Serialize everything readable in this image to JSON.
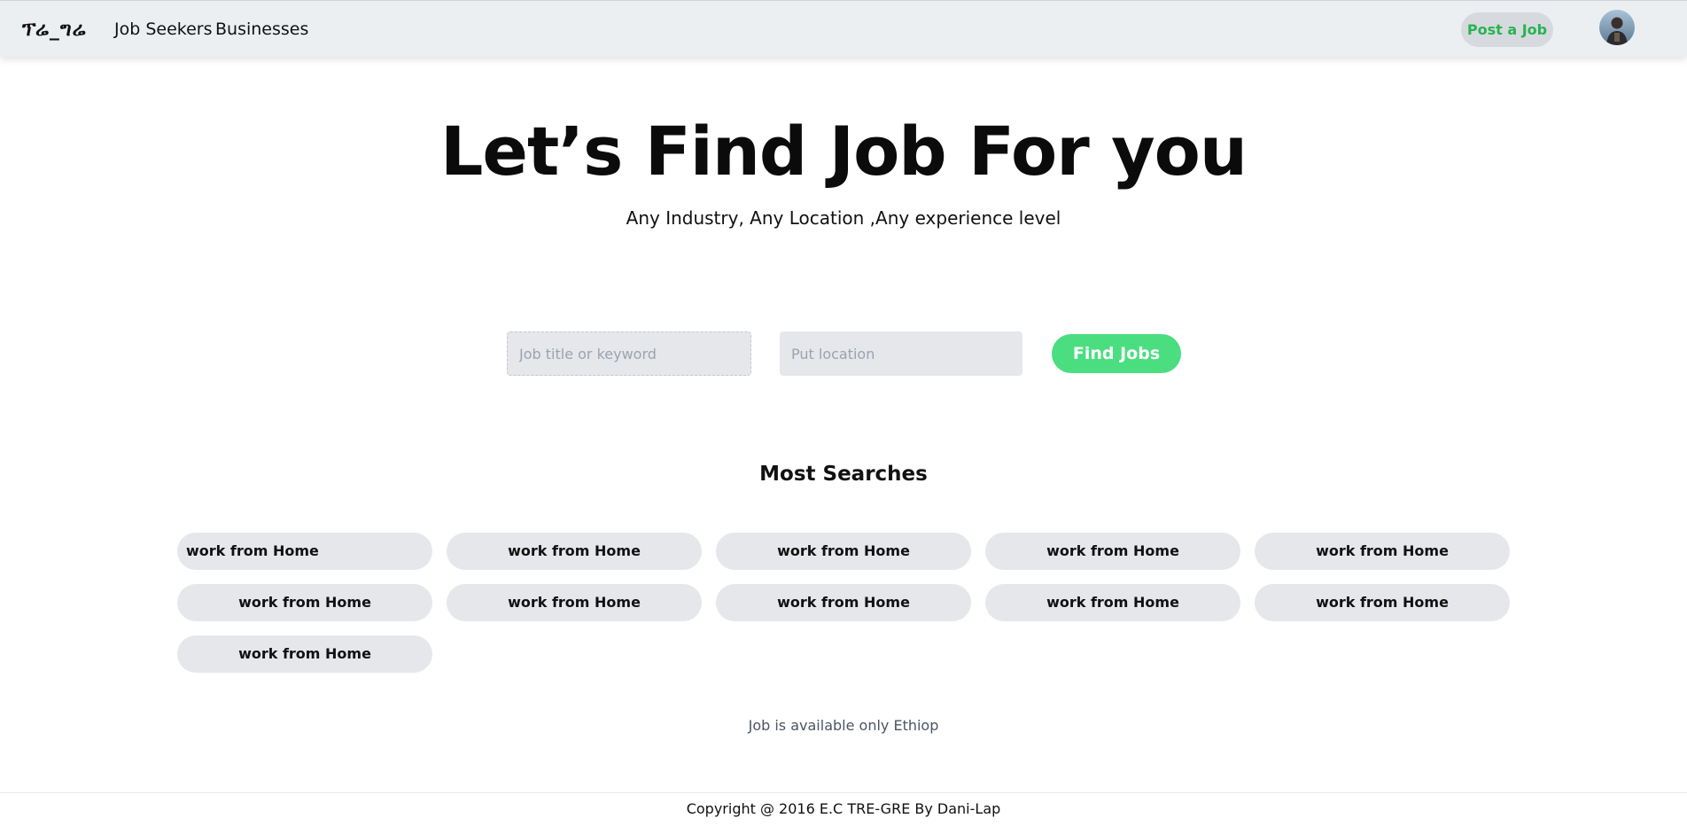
{
  "navbar": {
    "logo": "ፕሬ_ግሬ",
    "links": [
      "Job Seekers",
      "Businesses"
    ],
    "post_job_label": "Post a Job",
    "avatar_icon": "user-avatar-icon"
  },
  "hero": {
    "title": "Let’s Find Job For you",
    "subtitle": "Any Industry, Any Location ,Any experience level"
  },
  "search": {
    "keyword_placeholder": "Job title or keyword",
    "keyword_value": "",
    "location_placeholder": "Put location",
    "location_value": "",
    "button_label": "Find Jobs"
  },
  "most_searches": {
    "title": "Most Searches",
    "tags": [
      "work from Home",
      "work from Home",
      "work from Home",
      "work from Home",
      "work from Home",
      "work from Home",
      "work from Home",
      "work from Home",
      "work from Home",
      "work from Home",
      "work from Home"
    ]
  },
  "availability_note": "Job is available only Ethiop",
  "footer": {
    "copyright": "Copyright @ 2016 E.C TRE-GRE By Dani-Lap"
  },
  "colors": {
    "accent_green": "#4ade80",
    "post_job_text": "#27b352",
    "navbar_bg": "#eceff2",
    "tag_bg": "#e5e7eb"
  }
}
